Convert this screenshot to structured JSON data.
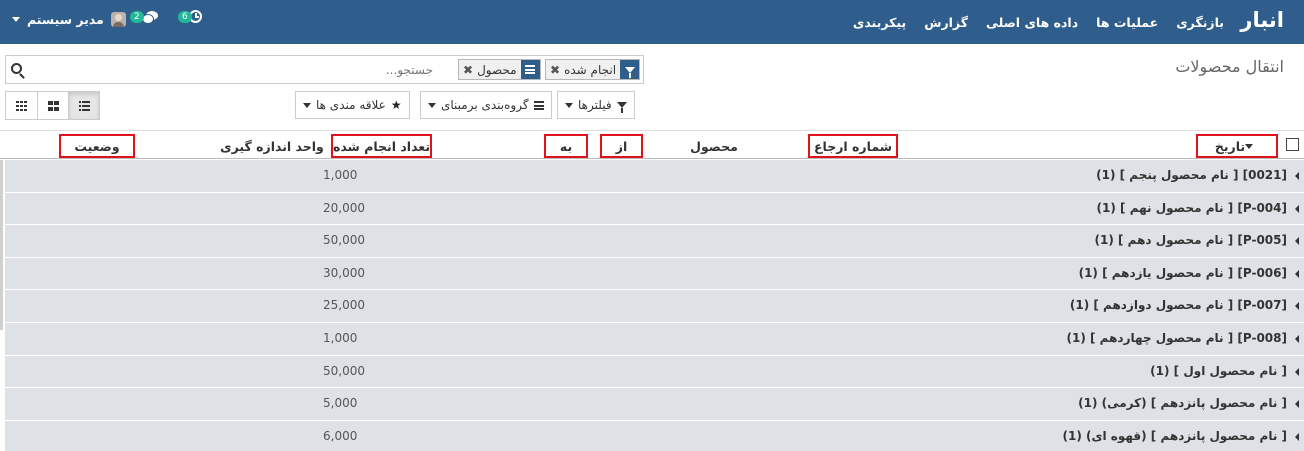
{
  "app": {
    "brand": "انبار"
  },
  "nav": {
    "menu": [
      "بازنگری",
      "عملیات ها",
      "داده های اصلی",
      "گزارش",
      "پیکربندی"
    ],
    "user_name": "مدیر سیستم",
    "messages_count": "2",
    "activities_count": "6"
  },
  "page": {
    "title": "انتقال محصولات"
  },
  "search": {
    "placeholder": "جستجو...",
    "facets": [
      {
        "icon": "filter-icon",
        "label": "انجام شده"
      },
      {
        "icon": "group-by-icon",
        "label": "محصول"
      }
    ]
  },
  "controls": {
    "filters_label": "فیلترها",
    "groupby_label": "گروه‌بندی برمبنای",
    "favorites_label": "علاقه مندی ها"
  },
  "table": {
    "columns": {
      "date": "تاریخ",
      "reference": "شماره ارجاع",
      "product": "محصول",
      "from": "از",
      "to": "به",
      "qty_done": "تعداد انجام شده",
      "uom": "واحد اندازه گیری",
      "status": "وضعیت"
    },
    "groups": [
      {
        "label": "[0021] [ نام محصول پنجم ] (1)",
        "qty": "1,000"
      },
      {
        "label": "[P-004] [ نام محصول نهم ] (1)",
        "qty": "20,000"
      },
      {
        "label": "[P-005] [ نام محصول دهم ] (1)",
        "qty": "50,000"
      },
      {
        "label": "[P-006] [ نام محصول یازدهم ] (1)",
        "qty": "30,000"
      },
      {
        "label": "[P-007] [ نام محصول دوازدهم ] (1)",
        "qty": "25,000"
      },
      {
        "label": "[P-008] [ نام محصول چهاردهم ] (1)",
        "qty": "1,000"
      },
      {
        "label": "[ نام محصول اول ] (1)",
        "qty": "50,000"
      },
      {
        "label": "[ نام محصول پانزدهم ] (کرمی) (1)",
        "qty": "5,000"
      },
      {
        "label": "[ نام محصول پانزدهم ] (قهوه ای) (1)",
        "qty": "6,000"
      }
    ]
  },
  "colors": {
    "navbar": "#2f5d8c",
    "badge": "#21b799",
    "highlight_box": "#e0121b",
    "group_row": "#dee2e6"
  }
}
